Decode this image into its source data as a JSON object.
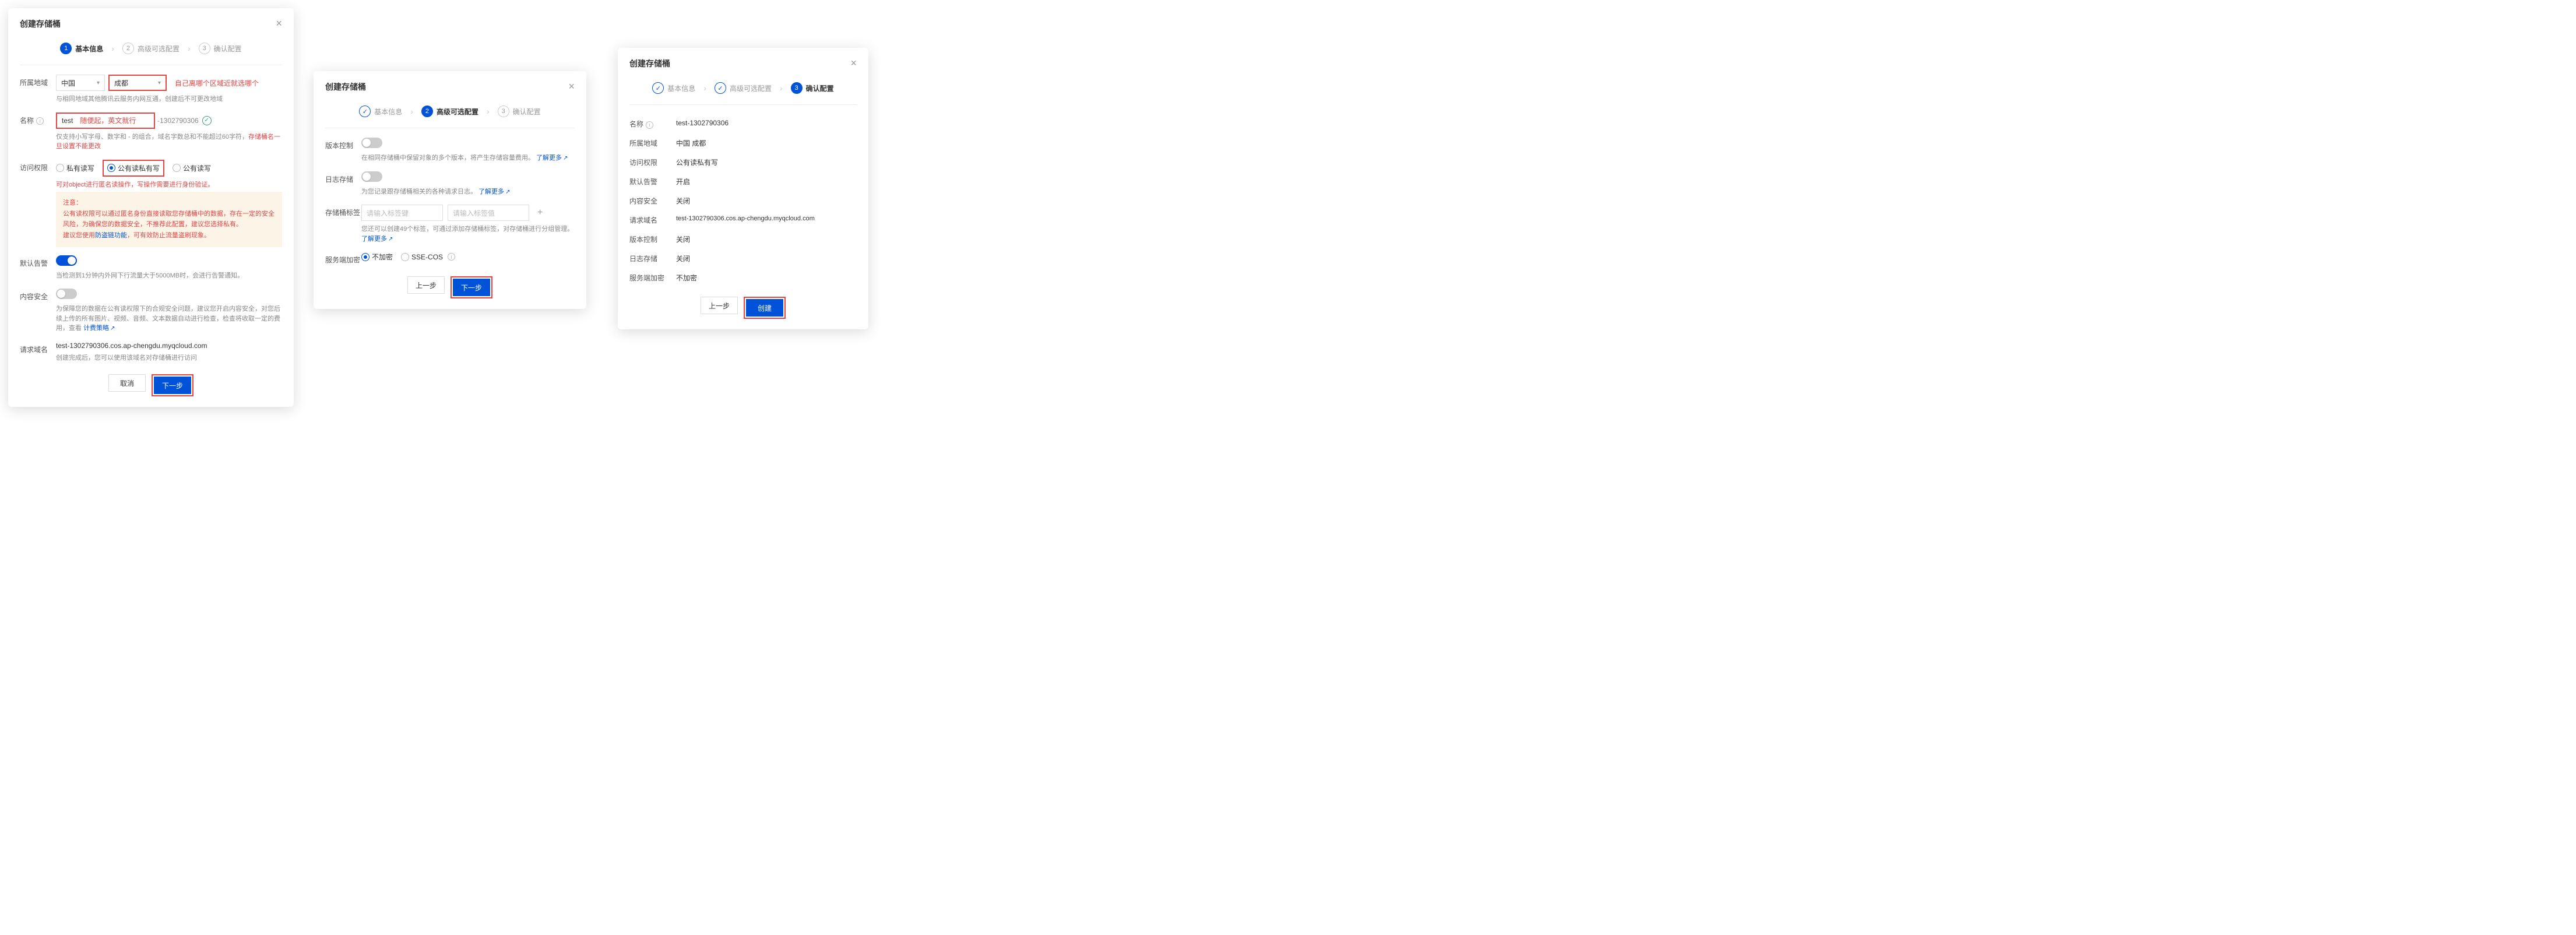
{
  "title": "创建存储桶",
  "steps": {
    "s1": "基本信息",
    "s2": "高级可选配置",
    "s3": "确认配置",
    "n1": "1",
    "n2": "2",
    "n3": "3"
  },
  "modal1": {
    "region_label": "所属地域",
    "country": "中国",
    "city": "成都",
    "region_annotation": "自己离哪个区域近就选哪个",
    "region_hint": "与相同地域其他腾讯云服务内网互通，创建后不可更改地域",
    "name_label": "名称",
    "name_value": "test",
    "name_annotation": "随便起，英文就行",
    "name_suffix": "-1302790306",
    "name_hint_a": "仅支持小写字母、数字和 - 的组合，域名字数总和不能超过60字符，",
    "name_hint_b": "存储桶名一旦设置不能更改",
    "perm_label": "访问权限",
    "perm_opts": {
      "a": "私有读写",
      "b": "公有读私有写",
      "c": "公有读写"
    },
    "perm_hint": "可对object进行匿名读操作，写操作需要进行身份验证。",
    "warn_title": "注意：",
    "warn_l1": "公有读权限可以通过匿名身份直接读取您存储桶中的数据，存在一定的安全风险，为确保您的数据安全，不推荐此配置，建议您选择私有。",
    "warn_l2a": "建议您使用",
    "warn_l2link": "防盗链功能",
    "warn_l2b": "，可有效防止流量盗刷现象。",
    "alert_label": "默认告警",
    "alert_hint": "当检测到1分钟内外网下行流量大于5000MB时，会进行告警通知。",
    "sec_label": "内容安全",
    "sec_hint_a": "为保障您的数据在公有读权限下的合规安全问题，建议您开启内容安全，对您后续上传的所有图片、视频、音频、文本数据自动进行检查，检查将收取一定的费用，查看 ",
    "sec_link": "计费策略",
    "domain_label": "请求域名",
    "domain_value": "test-1302790306.cos.ap-chengdu.myqcloud.com",
    "domain_hint": "创建完成后，您可以使用该域名对存储桶进行访问",
    "btn_cancel": "取消",
    "btn_next": "下一步"
  },
  "modal2": {
    "ver_label": "版本控制",
    "ver_hint_a": "在相同存储桶中保留对象的多个版本，将产生存储容量费用。",
    "learn_more": "了解更多",
    "log_label": "日志存储",
    "log_hint": "为您记录跟存储桶相关的各种请求日志。",
    "tag_label": "存储桶标签",
    "tag_key_ph": "请输入标签键",
    "tag_val_ph": "请输入标签值",
    "tag_hint_a": "您还可以创建49个标签，可通过添加存储桶标签，对存储桶进行分组管理。",
    "enc_label": "服务端加密",
    "enc_opts": {
      "a": "不加密",
      "b": "SSE-COS"
    },
    "btn_prev": "上一步",
    "btn_next": "下一步"
  },
  "modal3": {
    "rows": {
      "name_l": "名称",
      "name_v": "test-1302790306",
      "region_l": "所属地域",
      "region_v": "中国 成都",
      "perm_l": "访问权限",
      "perm_v": "公有读私有写",
      "alert_l": "默认告警",
      "alert_v": "开启",
      "sec_l": "内容安全",
      "sec_v": "关闭",
      "domain_l": "请求域名",
      "domain_v": "test-1302790306.cos.ap-chengdu.myqcloud.com",
      "ver_l": "版本控制",
      "ver_v": "关闭",
      "log_l": "日志存储",
      "log_v": "关闭",
      "enc_l": "服务端加密",
      "enc_v": "不加密"
    },
    "btn_prev": "上一步",
    "btn_create": "创建"
  }
}
